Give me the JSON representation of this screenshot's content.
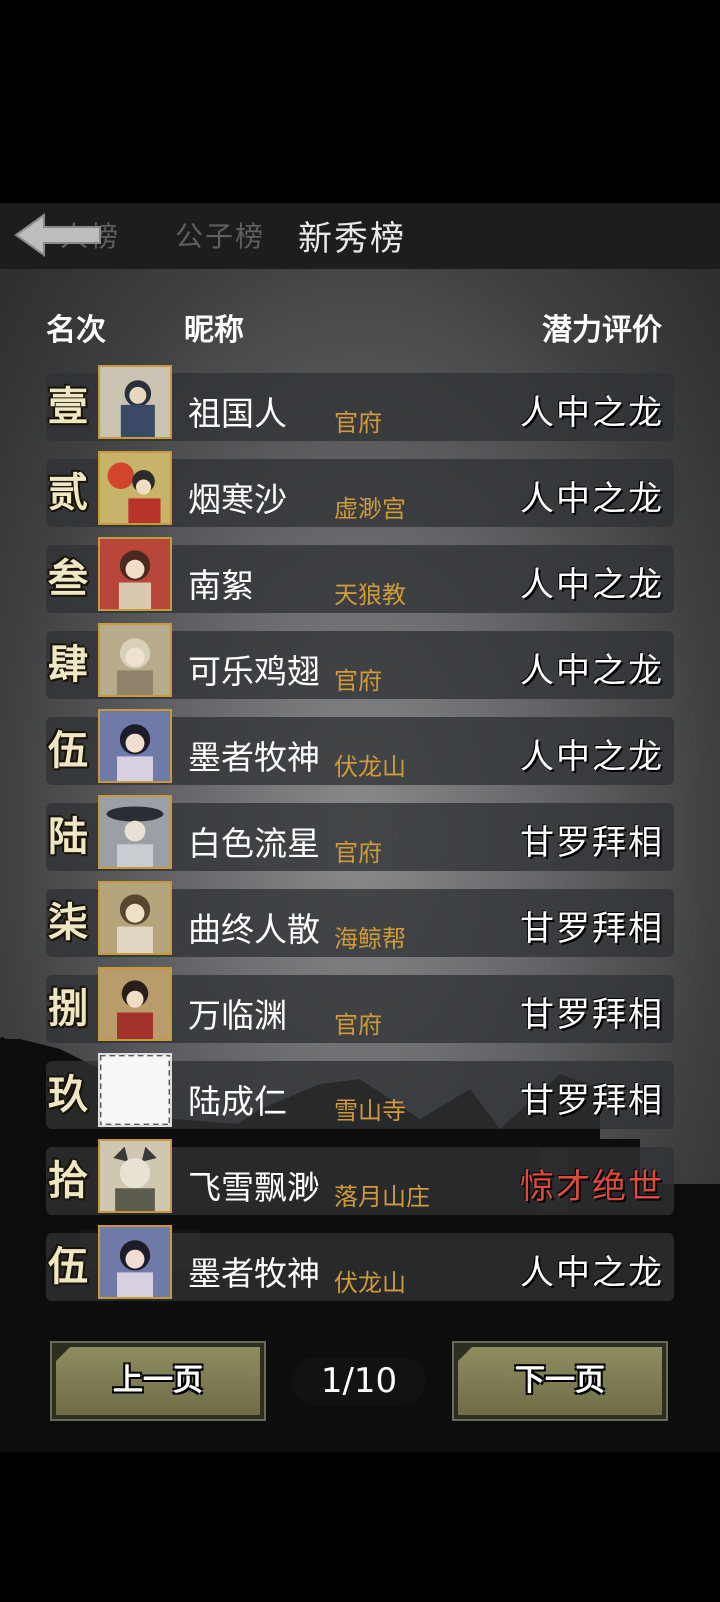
{
  "tabs": [
    {
      "label": "人榜"
    },
    {
      "label": "公子榜"
    },
    {
      "label": "新秀榜"
    }
  ],
  "header": {
    "rank": "名次",
    "nick": "昵称",
    "rating": "潜力评价"
  },
  "rows": [
    {
      "rank": "壹",
      "nick": "祖国人",
      "sect": "官府",
      "rating": "人中之龙",
      "rating_color": "#ffffff"
    },
    {
      "rank": "贰",
      "nick": "烟寒沙",
      "sect": "虚渺宫",
      "rating": "人中之龙",
      "rating_color": "#ffffff"
    },
    {
      "rank": "叁",
      "nick": "南絮",
      "sect": "天狼教",
      "rating": "人中之龙",
      "rating_color": "#ffffff"
    },
    {
      "rank": "肆",
      "nick": "可乐鸡翅",
      "sect": "官府",
      "rating": "人中之龙",
      "rating_color": "#ffffff"
    },
    {
      "rank": "伍",
      "nick": "墨者牧神",
      "sect": "伏龙山",
      "rating": "人中之龙",
      "rating_color": "#ffffff"
    },
    {
      "rank": "陆",
      "nick": "白色流星",
      "sect": "官府",
      "rating": "甘罗拜相",
      "rating_color": "#ffffff"
    },
    {
      "rank": "柒",
      "nick": "曲终人散",
      "sect": "海鲸帮",
      "rating": "甘罗拜相",
      "rating_color": "#ffffff"
    },
    {
      "rank": "捌",
      "nick": "万临渊",
      "sect": "官府",
      "rating": "甘罗拜相",
      "rating_color": "#ffffff"
    },
    {
      "rank": "玖",
      "nick": "陆成仁",
      "sect": "雪山寺",
      "rating": "甘罗拜相",
      "rating_color": "#ffffff"
    },
    {
      "rank": "拾",
      "nick": "飞雪飘渺",
      "sect": "落月山庄",
      "rating": "惊才绝世",
      "rating_color": "#e04a3a"
    },
    {
      "rank": "伍",
      "nick": "墨者牧神",
      "sect": "伏龙山",
      "rating": "人中之龙",
      "rating_color": "#ffffff"
    }
  ],
  "pager": {
    "prev": "上一页",
    "next": "下一页",
    "page": "1/10"
  },
  "colors": {
    "sect": "#cf9b3a",
    "rank": "#efe7c4",
    "avatar_border": "#c59a3a"
  }
}
